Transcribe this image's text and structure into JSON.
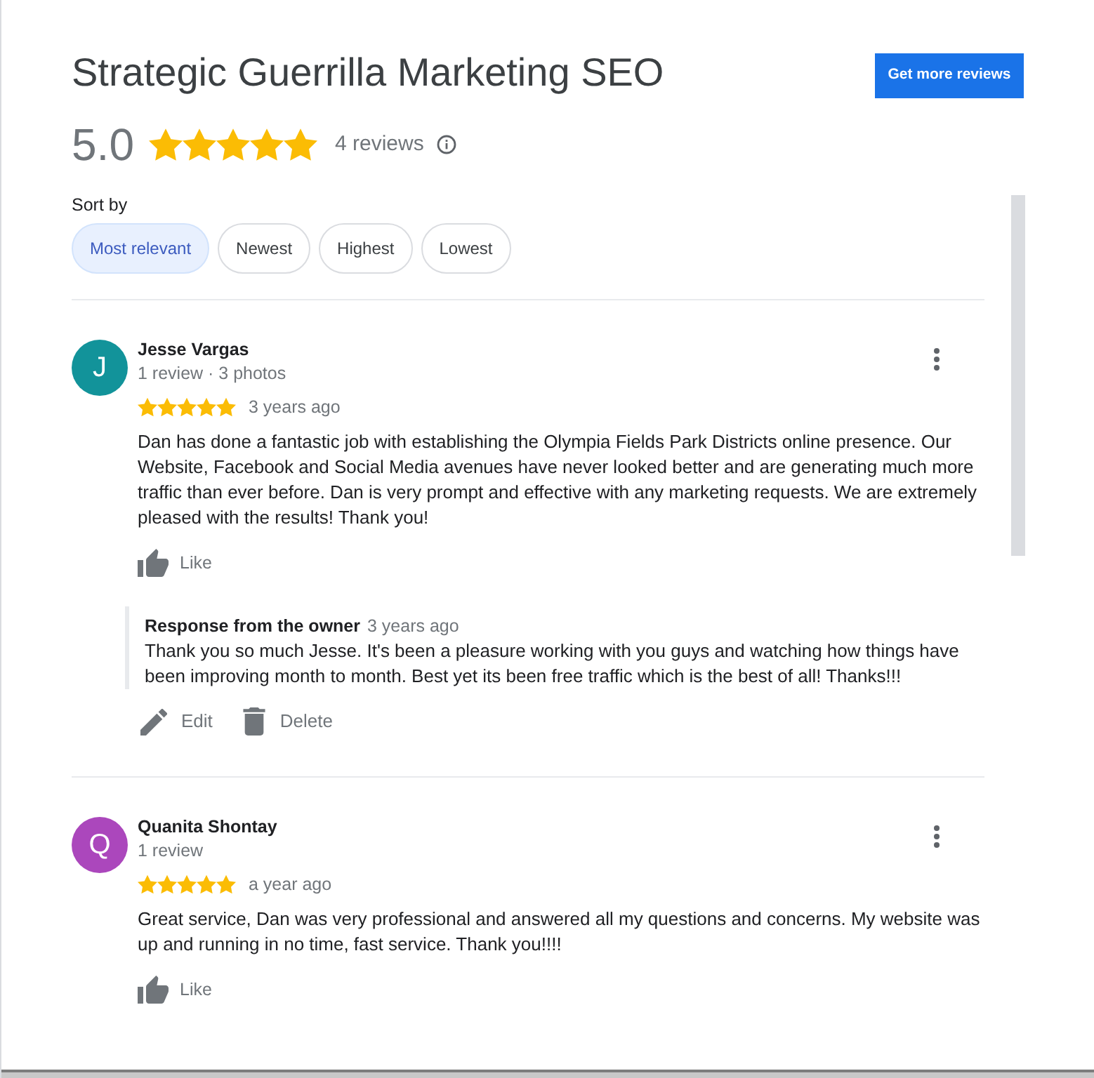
{
  "business": {
    "name": "Strategic Guerrilla Marketing SEO",
    "rating": "5.0",
    "stars": 5,
    "review_count": "4 reviews"
  },
  "get_more_reviews_button": "Get more reviews",
  "sort": {
    "label": "Sort by",
    "options": [
      {
        "label": "Most relevant",
        "selected": true
      },
      {
        "label": "Newest",
        "selected": false
      },
      {
        "label": "Highest",
        "selected": false
      },
      {
        "label": "Lowest",
        "selected": false
      }
    ]
  },
  "reviews": [
    {
      "avatar_letter": "J",
      "color": "#12939a",
      "author": "Jesse Vargas",
      "meta": "1 review · 3 photos",
      "stars": 5,
      "time": "3 years ago",
      "text": "Dan has done a fantastic job with establishing the Olympia Fields Park Districts online presence. Our Website, Facebook and Social Media avenues have never looked better and are generating much more traffic than ever before. Dan is very prompt and effective with any marketing requests. We are extremely pleased with the results! Thank you!",
      "like_label": "Like",
      "owner_response": {
        "label": "Response from the owner",
        "time": "3 years ago",
        "text": "Thank you so much Jesse. It's been a pleasure working with you guys and watching how things have been improving month to month. Best yet its been free traffic which is the best of all! Thanks!!!",
        "actions": [
          {
            "kind": "edit",
            "label": "Edit"
          },
          {
            "kind": "delete",
            "label": "Delete"
          }
        ]
      }
    },
    {
      "avatar_letter": "Q",
      "color": "#ab47bc",
      "author": "Quanita Shontay",
      "meta": "1 review",
      "stars": 5,
      "time": "a year ago",
      "text": "Great service, Dan was very professional and answered all my questions and concerns. My website was up and running in no time, fast service. Thank you!!!!",
      "like_label": "Like"
    }
  ]
}
